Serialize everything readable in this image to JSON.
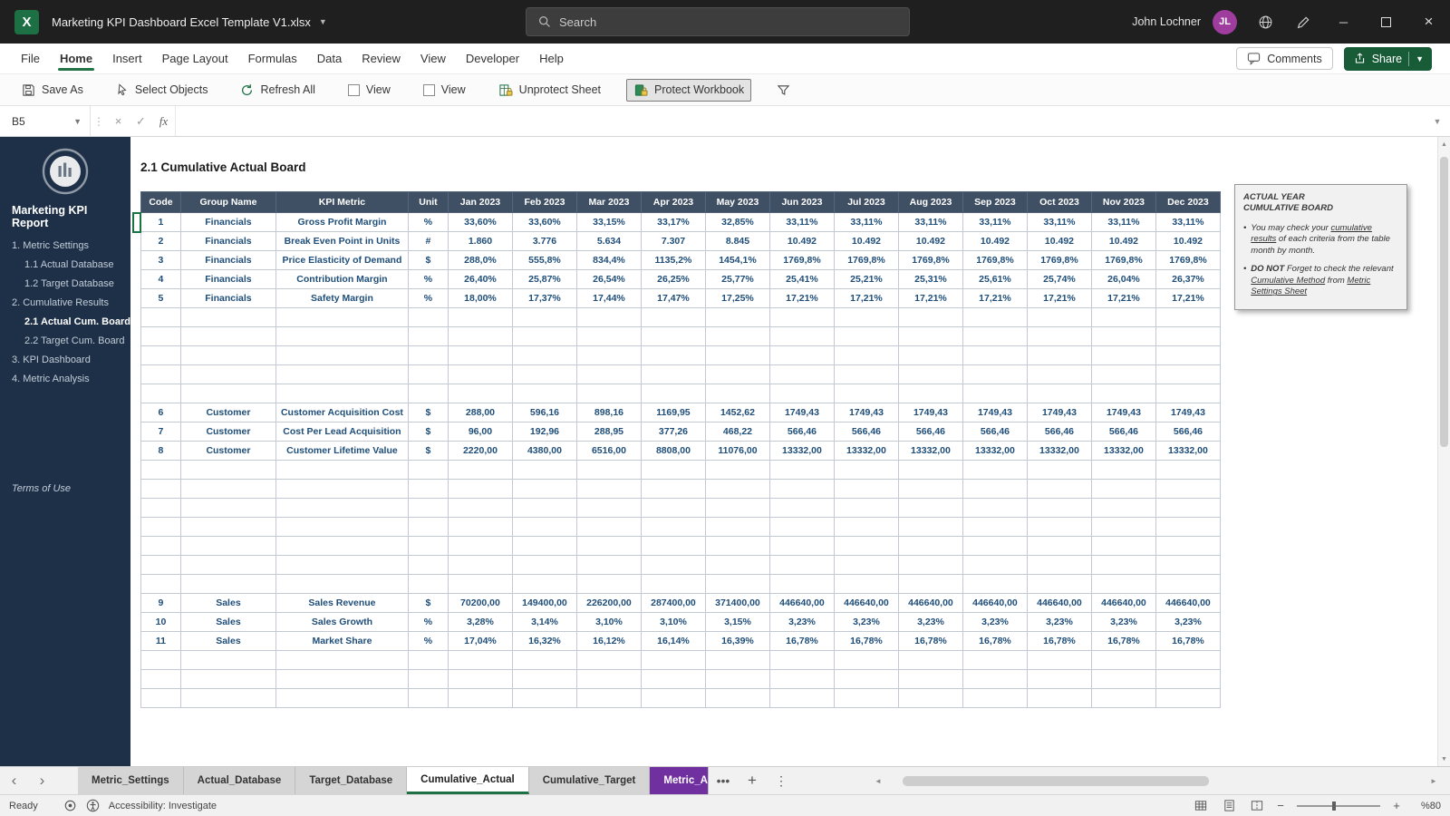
{
  "title_bar": {
    "document_title": "Marketing KPI Dashboard Excel Template V1.xlsx",
    "search_placeholder": "Search",
    "user_name": "John Lochner",
    "user_initials": "JL"
  },
  "menu": {
    "items": [
      "File",
      "Home",
      "Insert",
      "Page Layout",
      "Formulas",
      "Data",
      "Review",
      "View",
      "Developer",
      "Help"
    ],
    "active": "Home",
    "comments_label": "Comments",
    "share_label": "Share"
  },
  "ribbon": {
    "buttons": [
      {
        "name": "save-as-button",
        "label": "Save As",
        "icon": "save-icon"
      },
      {
        "name": "select-objects-button",
        "label": "Select Objects",
        "icon": "cursor-icon"
      },
      {
        "name": "refresh-all-button",
        "label": "Refresh All",
        "icon": "refresh-icon"
      },
      {
        "name": "view-checkbox-1",
        "label": "View",
        "icon": "checkbox"
      },
      {
        "name": "view-checkbox-2",
        "label": "View",
        "icon": "checkbox"
      },
      {
        "name": "unprotect-sheet-button",
        "label": "Unprotect Sheet",
        "icon": "unprotect-sheet-icon"
      },
      {
        "name": "protect-workbook-button",
        "label": "Protect Workbook",
        "icon": "protect-workbook-icon",
        "pressed": true
      },
      {
        "name": "filter-button",
        "label": "",
        "icon": "funnel-icon"
      }
    ]
  },
  "formula_bar": {
    "name_box": "B5",
    "fx_label": "fx",
    "formula_value": ""
  },
  "sidebar": {
    "report_title": "Marketing KPI Report",
    "items": [
      {
        "label": "1. Metric Settings",
        "indent": false,
        "active": false
      },
      {
        "label": "1.1 Actual Database",
        "indent": true,
        "active": false
      },
      {
        "label": "1.2 Target Database",
        "indent": true,
        "active": false
      },
      {
        "label": "2. Cumulative Results",
        "indent": false,
        "active": false
      },
      {
        "label": "2.1 Actual Cum. Board",
        "indent": true,
        "active": true
      },
      {
        "label": "2.2 Target Cum. Board",
        "indent": true,
        "active": false
      },
      {
        "label": "3. KPI Dashboard",
        "indent": false,
        "active": false
      },
      {
        "label": "4. Metric Analysis",
        "indent": false,
        "active": false
      }
    ],
    "terms_label": "Terms of Use"
  },
  "main": {
    "page_title": "2.1 Cumulative Actual Board",
    "table": {
      "headers": [
        "Code",
        "Group Name",
        "KPI Metric",
        "Unit",
        "Jan 2023",
        "Feb 2023",
        "Mar 2023",
        "Apr 2023",
        "May 2023",
        "Jun 2023",
        "Jul 2023",
        "Aug 2023",
        "Sep 2023",
        "Oct 2023",
        "Nov 2023",
        "Dec 2023"
      ],
      "rows": [
        {
          "code": "1",
          "group": "Financials",
          "metric": "Gross Profit Margin",
          "unit": "%",
          "values": [
            "33,60%",
            "33,60%",
            "33,15%",
            "33,17%",
            "32,85%",
            "33,11%",
            "33,11%",
            "33,11%",
            "33,11%",
            "33,11%",
            "33,11%",
            "33,11%"
          ]
        },
        {
          "code": "2",
          "group": "Financials",
          "metric": "Break Even Point in Units",
          "unit": "#",
          "values": [
            "1.860",
            "3.776",
            "5.634",
            "7.307",
            "8.845",
            "10.492",
            "10.492",
            "10.492",
            "10.492",
            "10.492",
            "10.492",
            "10.492"
          ]
        },
        {
          "code": "3",
          "group": "Financials",
          "metric": "Price Elasticity of Demand",
          "unit": "$",
          "values": [
            "288,0%",
            "555,8%",
            "834,4%",
            "1135,2%",
            "1454,1%",
            "1769,8%",
            "1769,8%",
            "1769,8%",
            "1769,8%",
            "1769,8%",
            "1769,8%",
            "1769,8%"
          ]
        },
        {
          "code": "4",
          "group": "Financials",
          "metric": "Contribution Margin",
          "unit": "%",
          "values": [
            "26,40%",
            "25,87%",
            "26,54%",
            "26,25%",
            "25,77%",
            "25,41%",
            "25,21%",
            "25,31%",
            "25,61%",
            "25,74%",
            "26,04%",
            "26,37%"
          ]
        },
        {
          "code": "5",
          "group": "Financials",
          "metric": "Safety Margin",
          "unit": "%",
          "values": [
            "18,00%",
            "17,37%",
            "17,44%",
            "17,47%",
            "17,25%",
            "17,21%",
            "17,21%",
            "17,21%",
            "17,21%",
            "17,21%",
            "17,21%",
            "17,21%"
          ],
          "blank_rows_after": 5
        },
        {
          "code": "6",
          "group": "Customer",
          "metric": "Customer Acquisition Cost",
          "unit": "$",
          "values": [
            "288,00",
            "596,16",
            "898,16",
            "1169,95",
            "1452,62",
            "1749,43",
            "1749,43",
            "1749,43",
            "1749,43",
            "1749,43",
            "1749,43",
            "1749,43"
          ]
        },
        {
          "code": "7",
          "group": "Customer",
          "metric": "Cost Per Lead Acquisition",
          "unit": "$",
          "values": [
            "96,00",
            "192,96",
            "288,95",
            "377,26",
            "468,22",
            "566,46",
            "566,46",
            "566,46",
            "566,46",
            "566,46",
            "566,46",
            "566,46"
          ]
        },
        {
          "code": "8",
          "group": "Customer",
          "metric": "Customer Lifetime Value",
          "unit": "$",
          "values": [
            "2220,00",
            "4380,00",
            "6516,00",
            "8808,00",
            "11076,00",
            "13332,00",
            "13332,00",
            "13332,00",
            "13332,00",
            "13332,00",
            "13332,00",
            "13332,00"
          ],
          "blank_rows_after": 7
        },
        {
          "code": "9",
          "group": "Sales",
          "metric": "Sales Revenue",
          "unit": "$",
          "values": [
            "70200,00",
            "149400,00",
            "226200,00",
            "287400,00",
            "371400,00",
            "446640,00",
            "446640,00",
            "446640,00",
            "446640,00",
            "446640,00",
            "446640,00",
            "446640,00"
          ]
        },
        {
          "code": "10",
          "group": "Sales",
          "metric": "Sales Growth",
          "unit": "%",
          "values": [
            "3,28%",
            "3,14%",
            "3,10%",
            "3,10%",
            "3,15%",
            "3,23%",
            "3,23%",
            "3,23%",
            "3,23%",
            "3,23%",
            "3,23%",
            "3,23%"
          ]
        },
        {
          "code": "11",
          "group": "Sales",
          "metric": "Market Share",
          "unit": "%",
          "values": [
            "17,04%",
            "16,32%",
            "16,12%",
            "16,14%",
            "16,39%",
            "16,78%",
            "16,78%",
            "16,78%",
            "16,78%",
            "16,78%",
            "16,78%",
            "16,78%"
          ],
          "blank_rows_after": 3
        }
      ]
    },
    "note": {
      "title_line1": "ACTUAL YEAR",
      "title_line2": "CUMULATIVE BOARD",
      "bullets": [
        {
          "segments": [
            {
              "t": "You may check your "
            },
            {
              "t": "cumulative results",
              "u": true
            },
            {
              "t": " of each criteria from the table month by month."
            }
          ]
        },
        {
          "segments": [
            {
              "t": "DO NOT",
              "b": true
            },
            {
              "t": " Forget to check the relevant "
            },
            {
              "t": "Cumulative Method",
              "u": true
            },
            {
              "t": " from "
            },
            {
              "t": "Metric Settings Sheet",
              "u": true
            }
          ]
        }
      ]
    }
  },
  "sheet_tabs": {
    "tabs": [
      {
        "label": "Metric_Settings",
        "style": "gray"
      },
      {
        "label": "Actual_Database",
        "style": "gray"
      },
      {
        "label": "Target_Database",
        "style": "gray"
      },
      {
        "label": "Cumulative_Actual",
        "style": "active"
      },
      {
        "label": "Cumulative_Target",
        "style": "gray"
      },
      {
        "label": "Metric_A",
        "style": "purple"
      }
    ]
  },
  "status_bar": {
    "ready_label": "Ready",
    "accessibility_label": "Accessibility: Investigate",
    "zoom_label": "%80"
  },
  "colors": {
    "excel_green": "#217346",
    "share_green": "#185C37",
    "sidebar_navy": "#1E3048",
    "header_slate": "#405064",
    "data_navy": "#1F4E79",
    "tab_purple": "#7030A0"
  }
}
